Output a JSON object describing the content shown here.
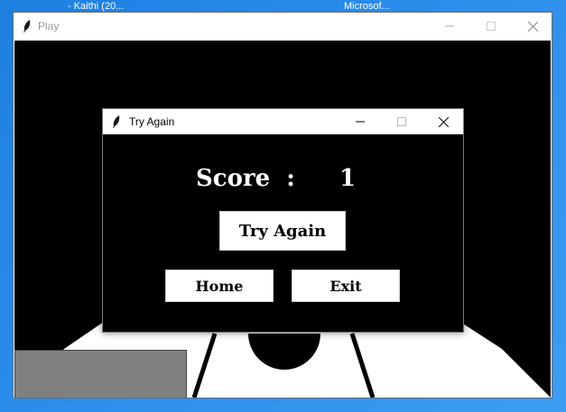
{
  "taskbar": {
    "item1": "- Kaithi (20...",
    "item2": "Microsof..."
  },
  "main_window": {
    "title": "Play",
    "controls": {
      "minimize": "—",
      "maximize": "☐",
      "close": "✕"
    }
  },
  "dialog": {
    "title": "Try Again",
    "controls": {
      "minimize": "—",
      "maximize": "☐",
      "close": "✕"
    },
    "score_label": "Score  :",
    "score_value": "1",
    "try_again_label": "Try Again",
    "home_label": "Home",
    "exit_label": "Exit"
  },
  "colors": {
    "desktop": "#2a8bea",
    "canvas": "#000000",
    "floor": "#ffffff",
    "block": "#808080"
  }
}
